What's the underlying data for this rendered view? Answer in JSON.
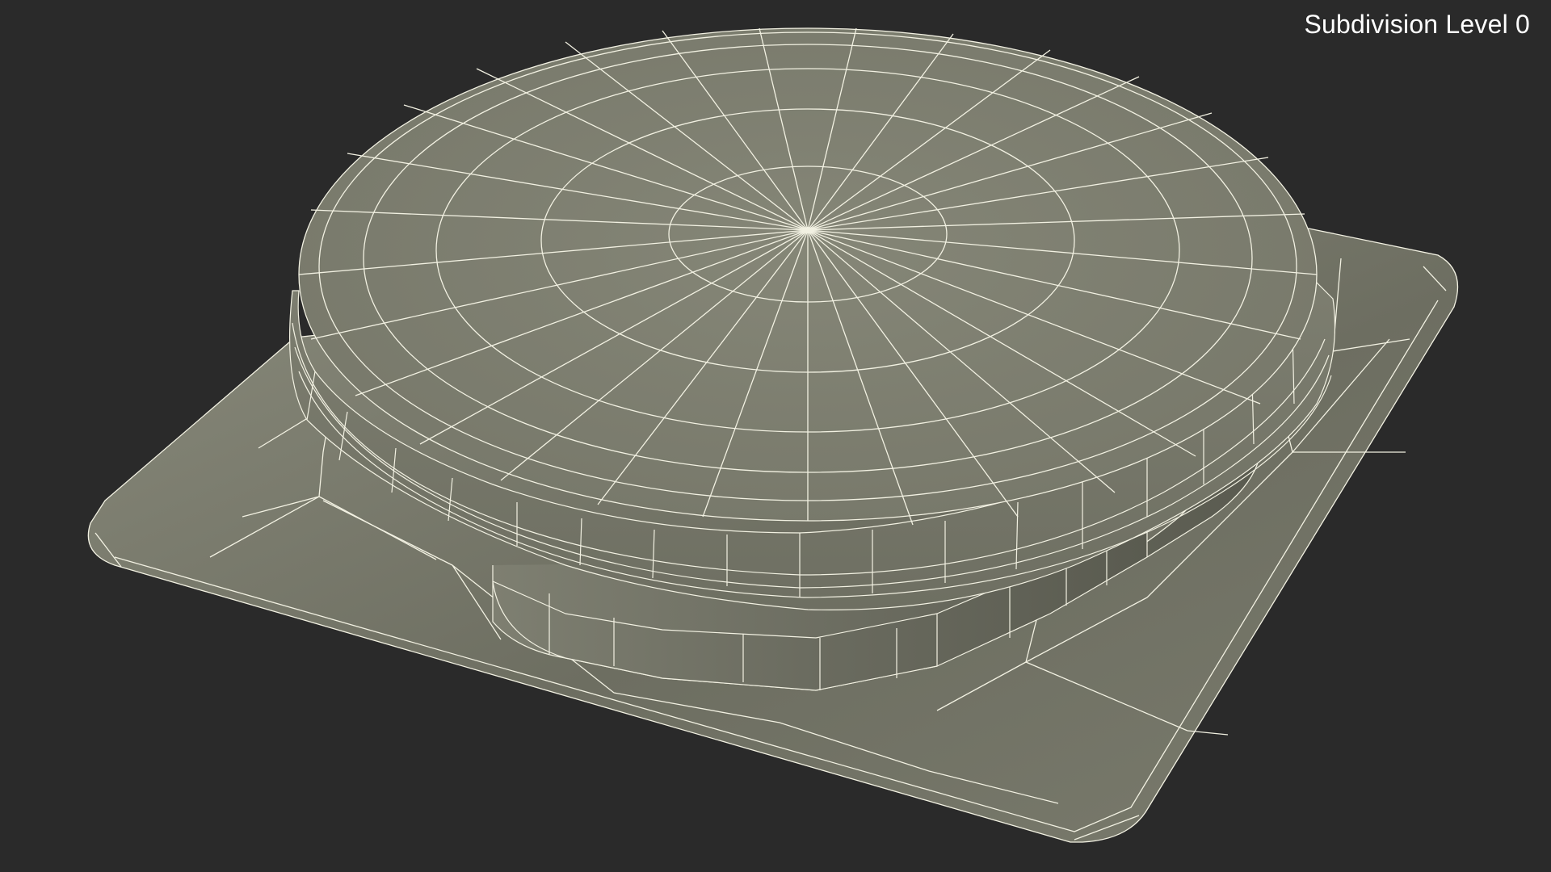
{
  "viewport": {
    "overlay_text": "Subdivision Level 0"
  },
  "colors": {
    "background": "#2a2a2a",
    "mesh_fill": "#7b7c6e",
    "mesh_shadow": "#5d5e52",
    "wire": "#f2f1e2"
  }
}
